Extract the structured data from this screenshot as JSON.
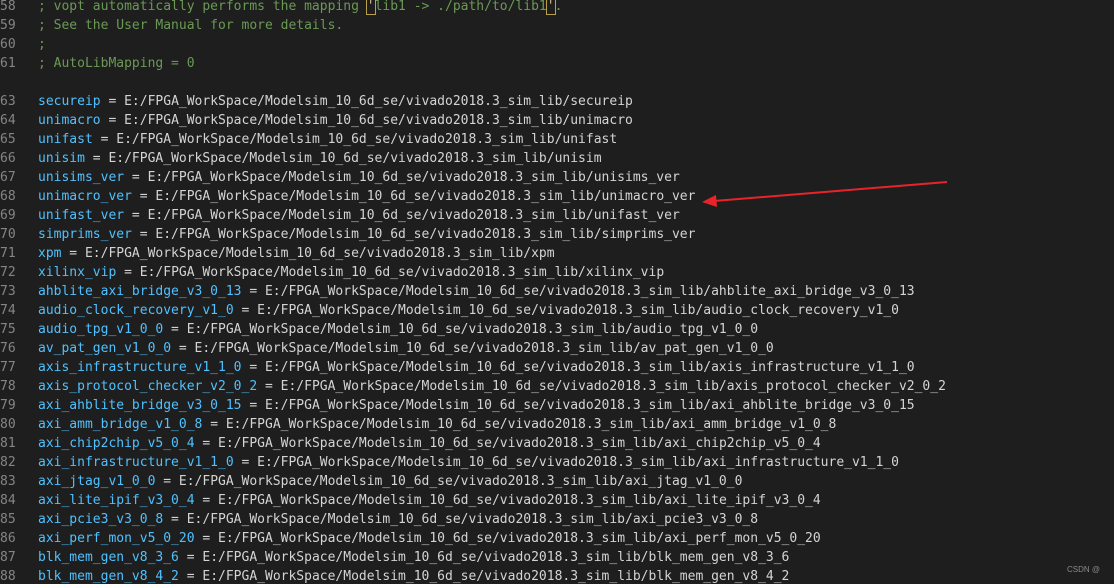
{
  "comments": [
    {
      "num": "58",
      "text": "; vopt automatically performs the mapping ",
      "hl1": "'",
      "mid": "lib1 -> ./path/to/lib1",
      "hl2": "'",
      "tail": "."
    },
    {
      "num": "59",
      "text": "; See the User Manual for more details."
    },
    {
      "num": "60",
      "text": ";"
    },
    {
      "num": "61",
      "text": "; AutoLibMapping = 0"
    }
  ],
  "mappings": [
    {
      "num": "63",
      "key": "secureip",
      "path": "E:/FPGA_WorkSpace/Modelsim_10_6d_se/vivado2018.3_sim_lib/secureip"
    },
    {
      "num": "64",
      "key": "unimacro",
      "path": "E:/FPGA_WorkSpace/Modelsim_10_6d_se/vivado2018.3_sim_lib/unimacro"
    },
    {
      "num": "65",
      "key": "unifast",
      "path": "E:/FPGA_WorkSpace/Modelsim_10_6d_se/vivado2018.3_sim_lib/unifast"
    },
    {
      "num": "66",
      "key": "unisim",
      "path": "E:/FPGA_WorkSpace/Modelsim_10_6d_se/vivado2018.3_sim_lib/unisim"
    },
    {
      "num": "67",
      "key": "unisims_ver",
      "path": "E:/FPGA_WorkSpace/Modelsim_10_6d_se/vivado2018.3_sim_lib/unisims_ver"
    },
    {
      "num": "68",
      "key": "unimacro_ver",
      "path": "E:/FPGA_WorkSpace/Modelsim_10_6d_se/vivado2018.3_sim_lib/unimacro_ver"
    },
    {
      "num": "69",
      "key": "unifast_ver",
      "path": "E:/FPGA_WorkSpace/Modelsim_10_6d_se/vivado2018.3_sim_lib/unifast_ver"
    },
    {
      "num": "70",
      "key": "simprims_ver",
      "path": "E:/FPGA_WorkSpace/Modelsim_10_6d_se/vivado2018.3_sim_lib/simprims_ver"
    },
    {
      "num": "71",
      "key": "xpm",
      "path": "E:/FPGA_WorkSpace/Modelsim_10_6d_se/vivado2018.3_sim_lib/xpm"
    },
    {
      "num": "72",
      "key": "xilinx_vip",
      "path": "E:/FPGA_WorkSpace/Modelsim_10_6d_se/vivado2018.3_sim_lib/xilinx_vip"
    },
    {
      "num": "73",
      "key": "ahblite_axi_bridge_v3_0_13",
      "path": "E:/FPGA_WorkSpace/Modelsim_10_6d_se/vivado2018.3_sim_lib/ahblite_axi_bridge_v3_0_13"
    },
    {
      "num": "74",
      "key": "audio_clock_recovery_v1_0",
      "path": "E:/FPGA_WorkSpace/Modelsim_10_6d_se/vivado2018.3_sim_lib/audio_clock_recovery_v1_0"
    },
    {
      "num": "75",
      "key": "audio_tpg_v1_0_0",
      "path": "E:/FPGA_WorkSpace/Modelsim_10_6d_se/vivado2018.3_sim_lib/audio_tpg_v1_0_0"
    },
    {
      "num": "76",
      "key": "av_pat_gen_v1_0_0",
      "path": "E:/FPGA_WorkSpace/Modelsim_10_6d_se/vivado2018.3_sim_lib/av_pat_gen_v1_0_0"
    },
    {
      "num": "77",
      "key": "axis_infrastructure_v1_1_0",
      "path": "E:/FPGA_WorkSpace/Modelsim_10_6d_se/vivado2018.3_sim_lib/axis_infrastructure_v1_1_0"
    },
    {
      "num": "78",
      "key": "axis_protocol_checker_v2_0_2",
      "path": "E:/FPGA_WorkSpace/Modelsim_10_6d_se/vivado2018.3_sim_lib/axis_protocol_checker_v2_0_2"
    },
    {
      "num": "79",
      "key": "axi_ahblite_bridge_v3_0_15",
      "path": "E:/FPGA_WorkSpace/Modelsim_10_6d_se/vivado2018.3_sim_lib/axi_ahblite_bridge_v3_0_15"
    },
    {
      "num": "80",
      "key": "axi_amm_bridge_v1_0_8",
      "path": "E:/FPGA_WorkSpace/Modelsim_10_6d_se/vivado2018.3_sim_lib/axi_amm_bridge_v1_0_8"
    },
    {
      "num": "81",
      "key": "axi_chip2chip_v5_0_4",
      "path": "E:/FPGA_WorkSpace/Modelsim_10_6d_se/vivado2018.3_sim_lib/axi_chip2chip_v5_0_4"
    },
    {
      "num": "82",
      "key": "axi_infrastructure_v1_1_0",
      "path": "E:/FPGA_WorkSpace/Modelsim_10_6d_se/vivado2018.3_sim_lib/axi_infrastructure_v1_1_0"
    },
    {
      "num": "83",
      "key": "axi_jtag_v1_0_0",
      "path": "E:/FPGA_WorkSpace/Modelsim_10_6d_se/vivado2018.3_sim_lib/axi_jtag_v1_0_0"
    },
    {
      "num": "84",
      "key": "axi_lite_ipif_v3_0_4",
      "path": "E:/FPGA_WorkSpace/Modelsim_10_6d_se/vivado2018.3_sim_lib/axi_lite_ipif_v3_0_4"
    },
    {
      "num": "85",
      "key": "axi_pcie3_v3_0_8",
      "path": "E:/FPGA_WorkSpace/Modelsim_10_6d_se/vivado2018.3_sim_lib/axi_pcie3_v3_0_8"
    },
    {
      "num": "86",
      "key": "axi_perf_mon_v5_0_20",
      "path": "E:/FPGA_WorkSpace/Modelsim_10_6d_se/vivado2018.3_sim_lib/axi_perf_mon_v5_0_20"
    },
    {
      "num": "87",
      "key": "blk_mem_gen_v8_3_6",
      "path": "E:/FPGA_WorkSpace/Modelsim_10_6d_se/vivado2018.3_sim_lib/blk_mem_gen_v8_3_6"
    },
    {
      "num": "88",
      "key": "blk_mem_gen_v8_4_2",
      "path": "E:/FPGA_WorkSpace/Modelsim_10_6d_se/vivado2018.3_sim_lib/blk_mem_gen_v8_4_2"
    }
  ],
  "watermark": "CSDN @",
  "colors": {
    "background": "#1e1e1e",
    "comment": "#6a9955",
    "key": "#4fc1ff",
    "text": "#d4d4d4",
    "arrow": "#e8232a"
  }
}
